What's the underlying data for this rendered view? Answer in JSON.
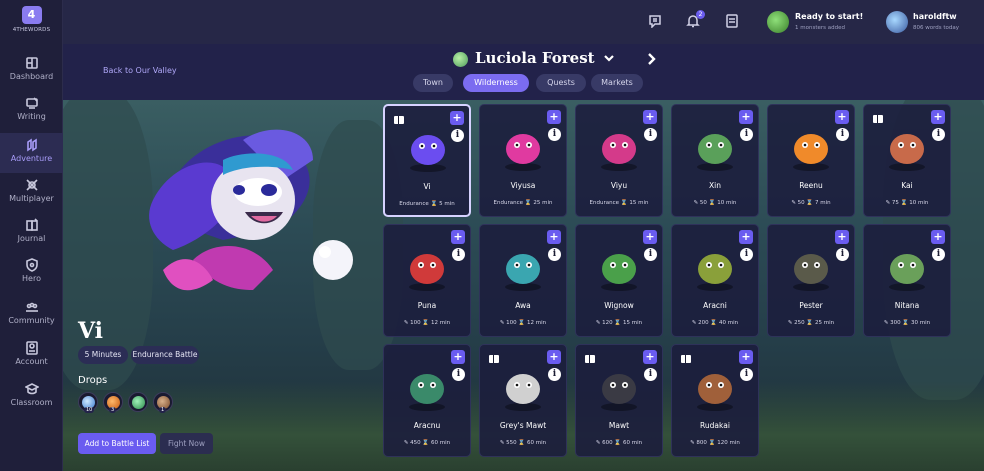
{
  "app": {
    "logo_number": "4",
    "logo_text": "4THEWORDS"
  },
  "sidebar": {
    "items": [
      {
        "label": "Dashboard",
        "icon": "dashboard-icon"
      },
      {
        "label": "Writing",
        "icon": "writing-icon"
      },
      {
        "label": "Adventure",
        "icon": "adventure-icon",
        "active": true
      },
      {
        "label": "Multiplayer",
        "icon": "multiplayer-icon"
      },
      {
        "label": "Journal",
        "icon": "journal-icon"
      },
      {
        "label": "Hero",
        "icon": "hero-icon"
      },
      {
        "label": "Community",
        "icon": "community-icon"
      },
      {
        "label": "Account",
        "icon": "account-icon"
      },
      {
        "label": "Classroom",
        "icon": "classroom-icon"
      }
    ]
  },
  "topbar": {
    "notification_count": "2",
    "ready": {
      "title": "Ready to start!",
      "subtitle": "1 monsters added"
    },
    "user": {
      "name": "haroldftw",
      "subtitle": "806 words today"
    }
  },
  "location": {
    "back_label": "Back to Our Valley",
    "title": "Luciola Forest",
    "tabs": [
      "Town",
      "Wilderness",
      "Quests",
      "Markets"
    ],
    "active_tab": "Wilderness"
  },
  "selected": {
    "name": "Vi",
    "chips": [
      "5 Minutes",
      "Endurance Battle"
    ],
    "drops_label": "Drops",
    "drops": [
      {
        "count": "10",
        "color": "#7ac0ff"
      },
      {
        "count": "3",
        "color": "#e87d2a"
      },
      {
        "count": "",
        "color": "#3fbf6f"
      },
      {
        "count": "1",
        "color": "#9c6a3a"
      }
    ],
    "add_button": "Add to Battle List",
    "fight_button": "Fight Now"
  },
  "monsters": [
    {
      "name": "Vi",
      "stats": "Endurance  ⌛ 5 min",
      "book": true,
      "selected": true,
      "color": "#6b4df0"
    },
    {
      "name": "Viyusa",
      "stats": "Endurance  ⌛ 25 min",
      "book": false,
      "color": "#e03aa0"
    },
    {
      "name": "Viyu",
      "stats": "Endurance  ⌛ 15 min",
      "book": false,
      "color": "#d43a8a"
    },
    {
      "name": "Xin",
      "stats": "✎ 50  ⌛ 10 min",
      "book": false,
      "color": "#5aa05a"
    },
    {
      "name": "Reenu",
      "stats": "✎ 50  ⌛ 7 min",
      "book": false,
      "color": "#f08a2a"
    },
    {
      "name": "Kai",
      "stats": "✎ 75  ⌛ 10 min",
      "book": true,
      "color": "#c86a4a"
    },
    {
      "name": "Puna",
      "stats": "✎ 100  ⌛ 12 min",
      "book": false,
      "color": "#d03a3a"
    },
    {
      "name": "Awa",
      "stats": "✎ 100  ⌛ 12 min",
      "book": false,
      "color": "#3aa6b0"
    },
    {
      "name": "Wignow",
      "stats": "✎ 120  ⌛ 15 min",
      "book": false,
      "color": "#4aa04a"
    },
    {
      "name": "Aracni",
      "stats": "✎ 200  ⌛ 40 min",
      "book": false,
      "color": "#8aa03a"
    },
    {
      "name": "Pester",
      "stats": "✎ 250  ⌛ 25 min",
      "book": false,
      "color": "#5a5a4a"
    },
    {
      "name": "Nitana",
      "stats": "✎ 300  ⌛ 30 min",
      "book": false,
      "color": "#6aa05a"
    },
    {
      "name": "Aracnu",
      "stats": "✎ 450  ⌛ 60 min",
      "book": false,
      "color": "#3a8a6a"
    },
    {
      "name": "Grey's Mawt",
      "stats": "✎ 550  ⌛ 60 min",
      "book": true,
      "color": "#d0d0d0"
    },
    {
      "name": "Mawt",
      "stats": "✎ 600  ⌛ 60 min",
      "book": true,
      "color": "#3a3a44"
    },
    {
      "name": "Rudakai",
      "stats": "✎ 800  ⌛ 120 min",
      "book": true,
      "color": "#a0603a"
    }
  ]
}
